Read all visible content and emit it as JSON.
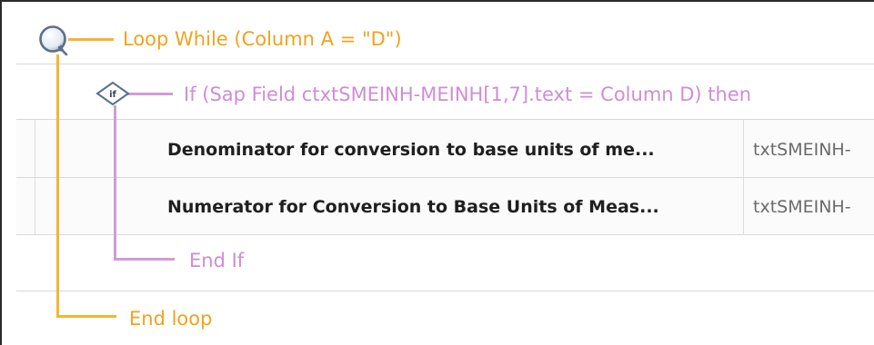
{
  "loop": {
    "label": "Loop While (Column A = \"D\")",
    "end_label": "End loop",
    "icon": "loop-icon",
    "color": "#f4b434"
  },
  "if_block": {
    "label": "If (Sap Field ctxtSMEINH-MEINH[1,7].text = Column D) then",
    "end_label": "End If",
    "icon_text": "if",
    "color": "#d39ad8"
  },
  "actions": [
    {
      "description": "Denominator for conversion to base units of me...",
      "field": "txtSMEINH-"
    },
    {
      "description": "Numerator for Conversion to Base Units of Meas...",
      "field": "txtSMEINH-"
    }
  ]
}
